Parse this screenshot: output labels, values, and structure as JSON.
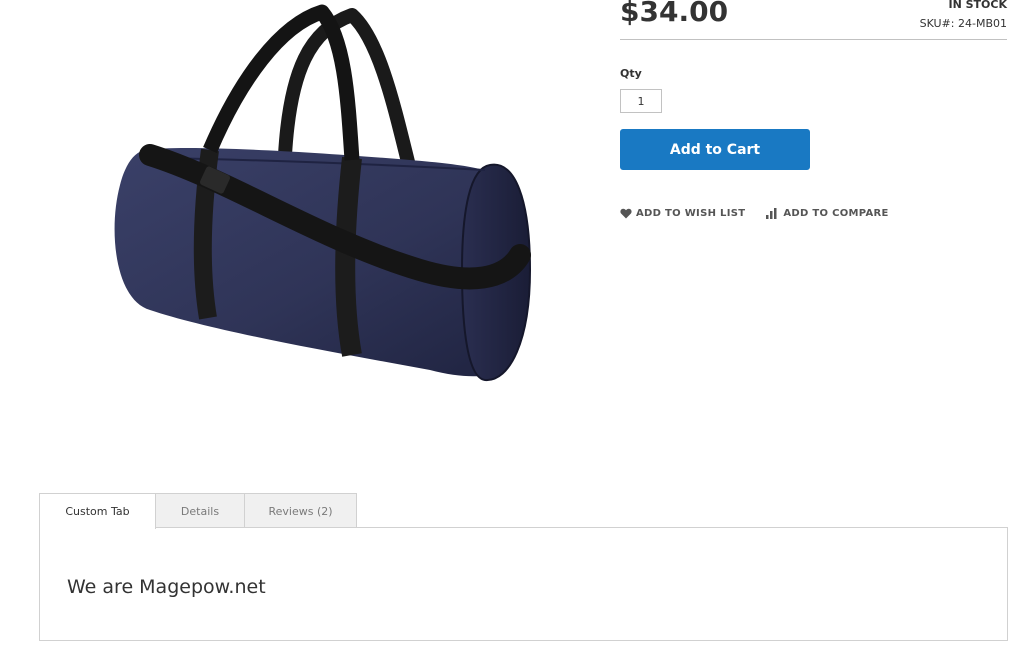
{
  "product": {
    "price": "$34.00",
    "stock": "IN STOCK",
    "sku_label": "SKU#:",
    "sku_value": "24-MB01"
  },
  "form": {
    "qty_label": "Qty",
    "qty_value": "1",
    "add_to_cart_label": "Add to Cart"
  },
  "actions": {
    "wishlist_label": "ADD TO WISH LIST",
    "compare_label": "ADD TO COMPARE"
  },
  "tabs": [
    {
      "label": "Custom Tab",
      "active": true
    },
    {
      "label": "Details",
      "active": false
    },
    {
      "label": "Reviews (2)",
      "active": false
    }
  ],
  "tab_content": {
    "text": "We are Magepow.net"
  },
  "colors": {
    "primary_button": "#1979c3",
    "bag_body": "#2f3457",
    "bag_straps": "#1c1c1c"
  },
  "icons": {
    "wishlist": "heart-icon",
    "compare": "bar-chart-icon"
  }
}
